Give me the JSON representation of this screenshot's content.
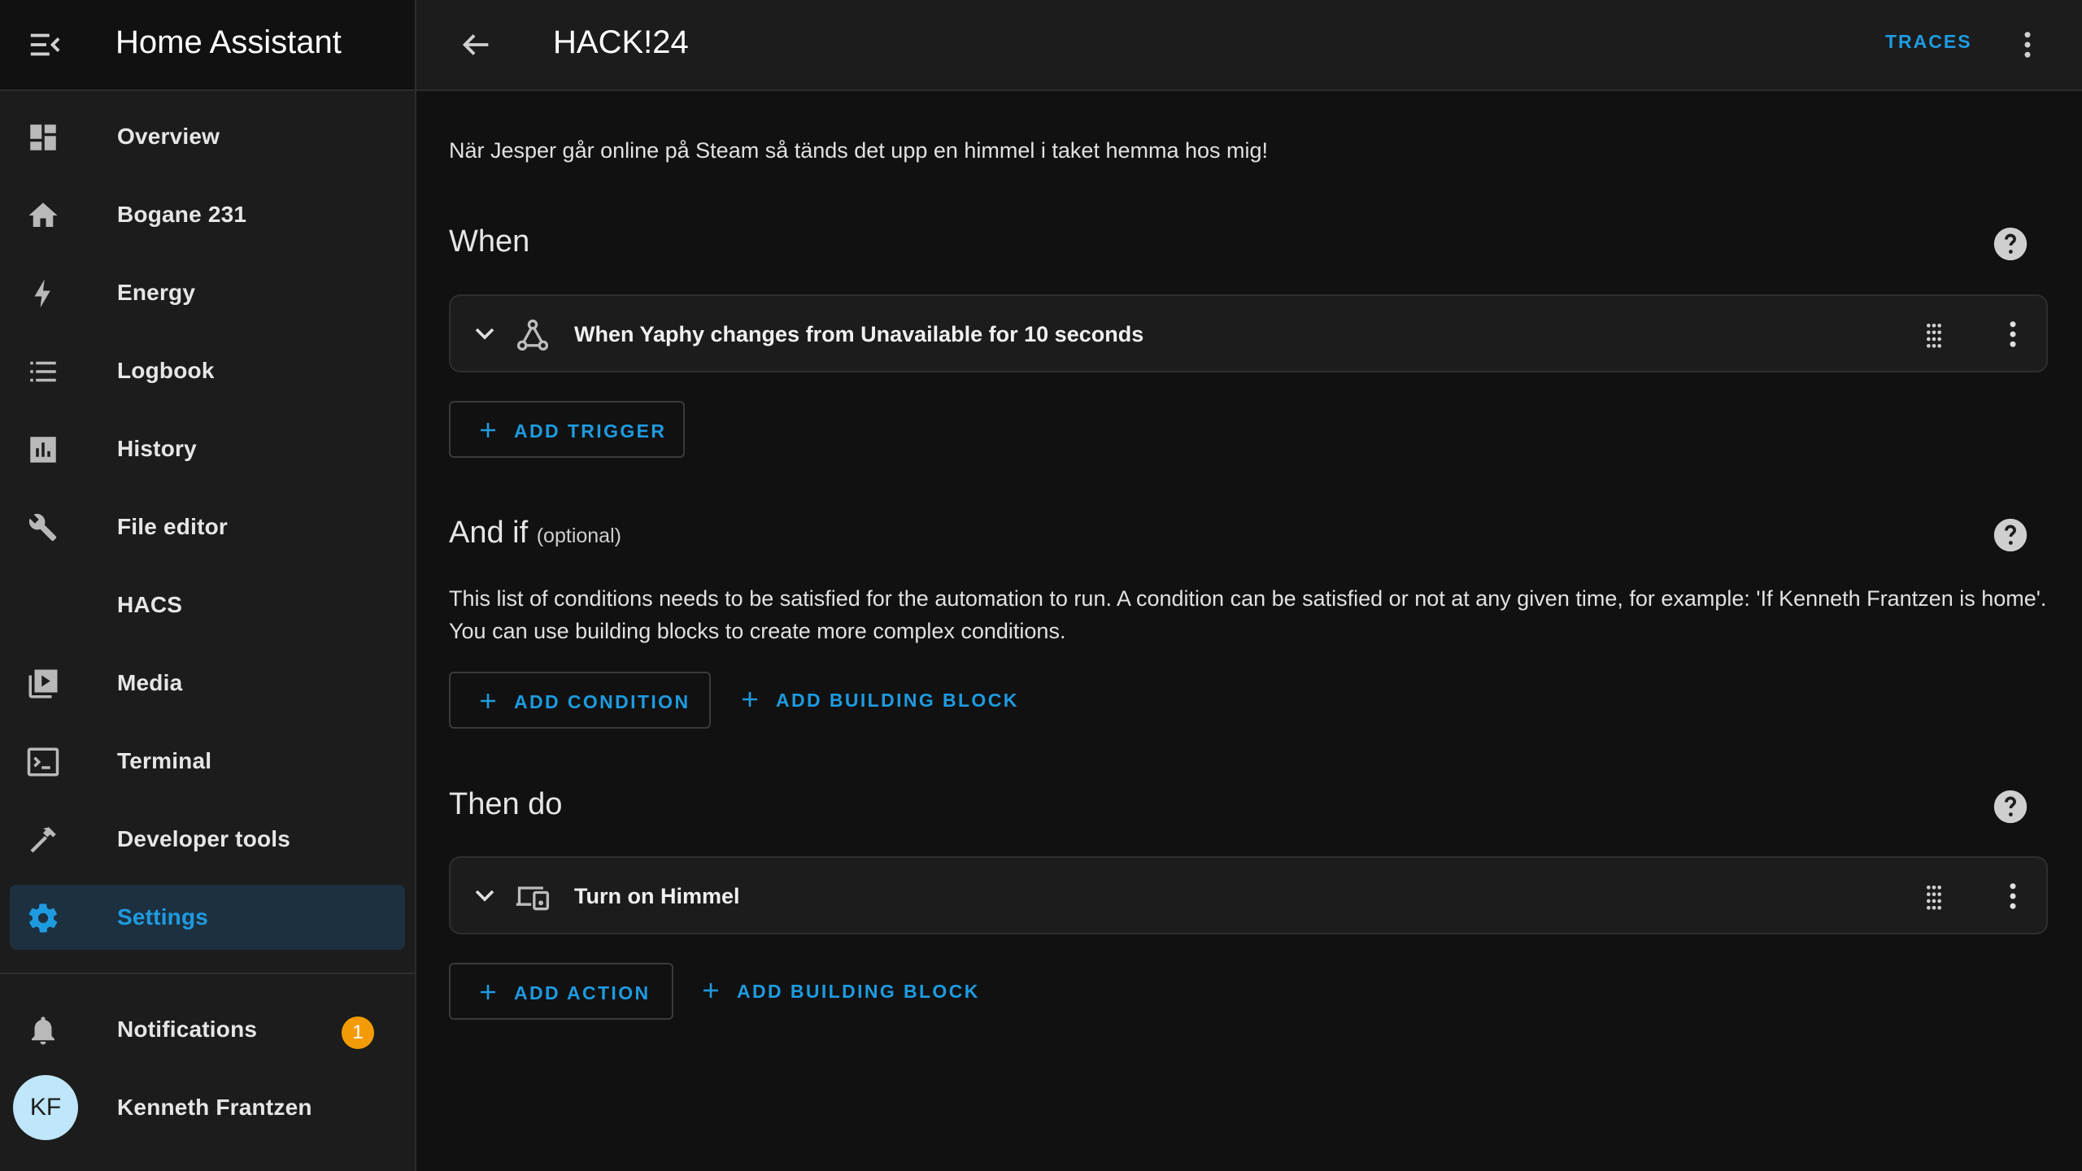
{
  "sidebar": {
    "title": "Home Assistant",
    "items": [
      {
        "label": "Overview",
        "icon": "dashboard-icon"
      },
      {
        "label": "Bogane 231",
        "icon": "home-icon"
      },
      {
        "label": "Energy",
        "icon": "lightning-icon"
      },
      {
        "label": "Logbook",
        "icon": "list-icon"
      },
      {
        "label": "History",
        "icon": "chart-bar-icon"
      },
      {
        "label": "File editor",
        "icon": "wrench-icon"
      },
      {
        "label": "HACS",
        "icon": ""
      },
      {
        "label": "Media",
        "icon": "media-play-icon"
      },
      {
        "label": "Terminal",
        "icon": "console-icon"
      },
      {
        "label": "Developer tools",
        "icon": "hammer-icon"
      },
      {
        "label": "Settings",
        "icon": "gear-icon",
        "active": true
      }
    ],
    "notifications": {
      "label": "Notifications",
      "count": "1"
    },
    "user": {
      "name": "Kenneth Frantzen",
      "initials": "KF"
    }
  },
  "header": {
    "title": "HACK!24",
    "traces_label": "TRACES"
  },
  "description": "När Jesper går online på Steam så tänds det upp en himmel i taket hemma hos mig!",
  "sections": {
    "when": {
      "title": "When",
      "trigger": "When Yaphy changes from Unavailable for 10 seconds",
      "add_trigger": "ADD TRIGGER"
    },
    "and_if": {
      "title": "And if",
      "optional": "(optional)",
      "text": "This list of conditions needs to be satisfied for the automation to run. A condition can be satisfied or not at any given time, for example: 'If Kenneth Frantzen is home'. You can use building blocks to create more complex conditions.",
      "add_condition": "ADD CONDITION",
      "add_building_block": "ADD BUILDING BLOCK"
    },
    "then_do": {
      "title": "Then do",
      "action": "Turn on Himmel",
      "add_action": "ADD ACTION",
      "add_building_block": "ADD BUILDING BLOCK"
    }
  },
  "colors": {
    "accent": "#1e9be0",
    "badge": "#f39b06",
    "active_bg": "#1c3040",
    "background": "#111111",
    "card": "#1c1c1c"
  }
}
